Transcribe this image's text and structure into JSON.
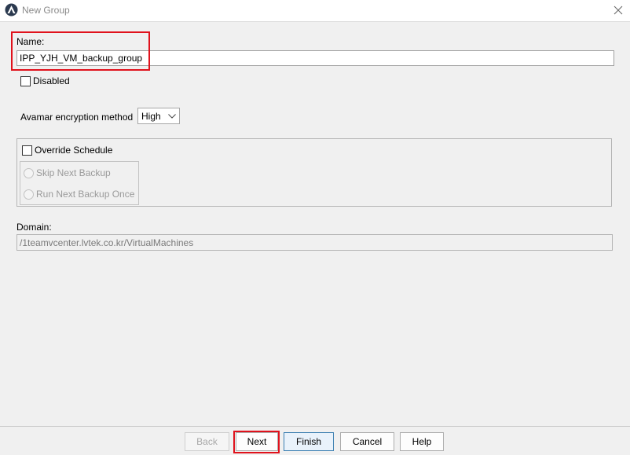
{
  "window": {
    "title": "New Group",
    "icon": "avamar-logo-icon",
    "close_icon": "close-icon"
  },
  "form": {
    "name_label": "Name:",
    "name_value": "IPP_YJH_VM_backup_group",
    "disabled_label": "Disabled",
    "disabled_checked": false,
    "encryption_label": "Avamar encryption method",
    "encryption_value": "High",
    "override_label": "Override Schedule",
    "override_checked": false,
    "skip_label": "Skip Next Backup",
    "run_once_label": "Run Next Backup Once",
    "domain_label": "Domain:",
    "domain_value": "/1teamvcenter.lvtek.co.kr/VirtualMachines"
  },
  "footer": {
    "back_label": "Back",
    "next_label": "Next",
    "finish_label": "Finish",
    "cancel_label": "Cancel",
    "help_label": "Help"
  },
  "colors": {
    "highlight": "#e0121c",
    "background": "#f0f0f0",
    "default_button_border": "#3c7fb1"
  }
}
